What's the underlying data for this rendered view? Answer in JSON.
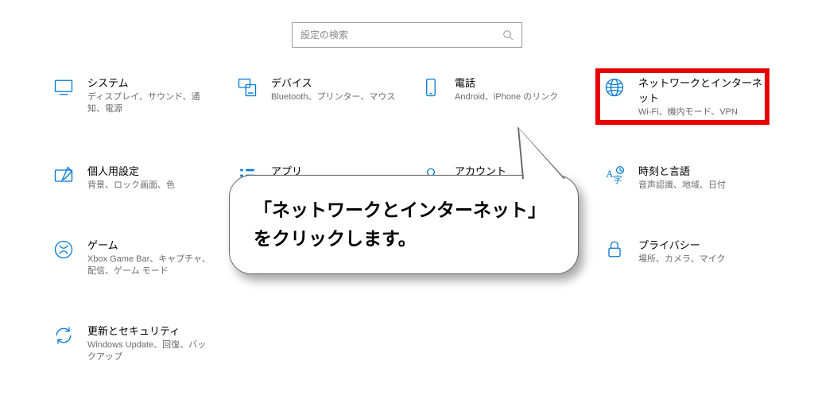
{
  "search": {
    "placeholder": "設定の検索"
  },
  "tiles": [
    {
      "title": "システム",
      "desc": "ディスプレイ、サウンド、通知、電源"
    },
    {
      "title": "デバイス",
      "desc": "Bluetooth、プリンター、マウス"
    },
    {
      "title": "電話",
      "desc": "Android、iPhone のリンク"
    },
    {
      "title": "ネットワークとインターネット",
      "desc": "Wi-Fi、機内モード、VPN"
    },
    {
      "title": "個人用設定",
      "desc": "背景、ロック画面、色"
    },
    {
      "title": "アプリ",
      "desc": ""
    },
    {
      "title": "アカウント",
      "desc": ""
    },
    {
      "title": "時刻と言語",
      "desc": "音声認識、地域、日付"
    },
    {
      "title": "ゲーム",
      "desc": "Xbox Game Bar、キャプチャ、配信、ゲーム モード"
    },
    {
      "title": "",
      "desc": ""
    },
    {
      "title": "",
      "desc": ""
    },
    {
      "title": "プライバシー",
      "desc": "場所、カメラ、マイク"
    },
    {
      "title": "更新とセキュリティ",
      "desc": "Windows Update、回復、バックアップ"
    }
  ],
  "callout": {
    "text": "「ネットワークとインターネット」をクリックします。"
  },
  "colors": {
    "accent": "#0078d4",
    "highlight": "#e60000"
  }
}
